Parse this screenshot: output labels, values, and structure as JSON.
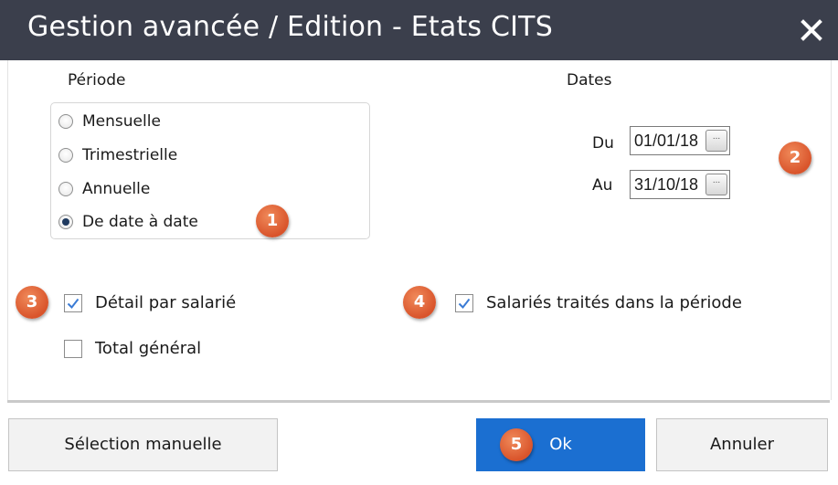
{
  "window": {
    "title": "Gestion avancée / Edition - Etats CITS",
    "close_icon": "close-icon"
  },
  "periode": {
    "label": "Période",
    "options": [
      {
        "label": "Mensuelle",
        "checked": false
      },
      {
        "label": "Trimestrielle",
        "checked": false
      },
      {
        "label": "Annuelle",
        "checked": false
      },
      {
        "label": "De date à date",
        "checked": true
      }
    ]
  },
  "dates": {
    "label": "Dates",
    "du_label": "Du",
    "du_value": "01/01/18",
    "au_label": "Au",
    "au_value": "31/10/18",
    "picker_glyph": "..."
  },
  "options": {
    "detail_par_salarie": {
      "label": "Détail par salarié",
      "checked": true
    },
    "total_general": {
      "label": "Total général",
      "checked": false
    },
    "salaries_traites": {
      "label": "Salariés traités dans la période",
      "checked": true
    }
  },
  "badges": [
    "1",
    "2",
    "3",
    "4",
    "5"
  ],
  "buttons": {
    "selection_manuelle": "Sélection manuelle",
    "ok": "Ok",
    "annuler": "Annuler"
  },
  "colors": {
    "titlebar": "#3b3f4c",
    "badge": "#d9542b",
    "primary_button": "#1b6fd1",
    "check_mark": "#3a7bd5"
  }
}
